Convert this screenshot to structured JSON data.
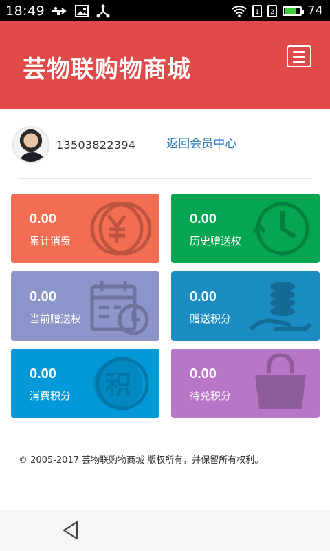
{
  "status_bar": {
    "time": "18:49",
    "battery_level": "74",
    "battery_fraction": 0.74,
    "icons_left": [
      "usb-icon",
      "image-icon",
      "share-icon"
    ],
    "icons_right": [
      "wifi-icon",
      "sim1-icon",
      "sim2-icon",
      "battery-icon"
    ]
  },
  "header": {
    "title": "芸物联购物商城",
    "menu_icon": "hamburger-menu-icon",
    "background": "#e04a48"
  },
  "user": {
    "phone": "13503822394",
    "member_center_link": "返回会员中心"
  },
  "cards": [
    {
      "value": "0.00",
      "label": "累计消费",
      "color": "#f26d52",
      "icon": "yen-coin-icon"
    },
    {
      "value": "0.00",
      "label": "历史赠送权",
      "color": "#05a552",
      "icon": "clock-history-icon"
    },
    {
      "value": "0.00",
      "label": "当前赠送权",
      "color": "#8c95c9",
      "icon": "calendar-clock-icon"
    },
    {
      "value": "0.00",
      "label": "赠送积分",
      "color": "#1a8cc2",
      "icon": "coins-hand-icon"
    },
    {
      "value": "0.00",
      "label": "消费积分",
      "color": "#0399d9",
      "icon": "points-coin-icon",
      "icon_text": "积"
    },
    {
      "value": "0.00",
      "label": "待兑积分",
      "color": "#b876c7",
      "icon": "yen-lock-bag-icon"
    }
  ],
  "footer": {
    "copyright": "© 2005-2017 芸物联购物商城 版权所有，并保留所有权利。"
  },
  "nav": {
    "back_icon": "back-triangle-icon"
  }
}
